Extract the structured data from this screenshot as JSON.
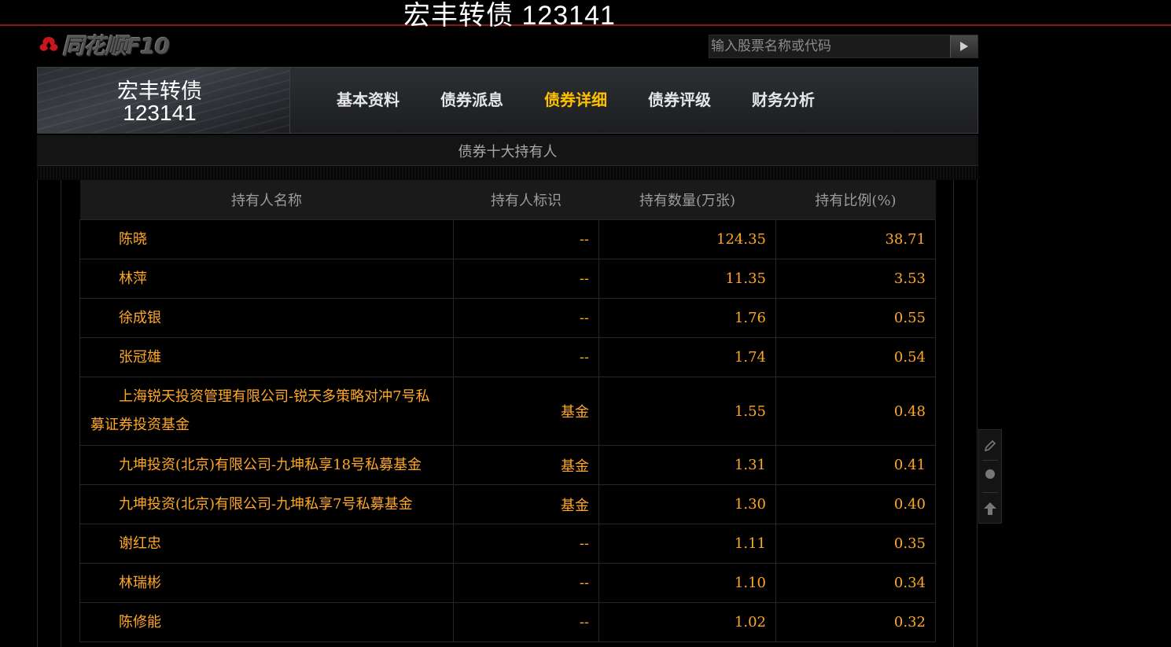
{
  "window": {
    "title": "宏丰转债 123141"
  },
  "brand": {
    "logo_text": "同花顺F10"
  },
  "search": {
    "placeholder": "输入股票名称或代码"
  },
  "stock": {
    "name": "宏丰转债",
    "code": "123141"
  },
  "nav": {
    "tabs": [
      {
        "label": "基本资料",
        "active": false
      },
      {
        "label": "债券派息",
        "active": false
      },
      {
        "label": "债券详细",
        "active": true
      },
      {
        "label": "债券评级",
        "active": false
      },
      {
        "label": "财务分析",
        "active": false
      }
    ]
  },
  "section": {
    "title": "债券十大持有人"
  },
  "table": {
    "headers": [
      "持有人名称",
      "持有人标识",
      "持有数量(万张)",
      "持有比例(%)"
    ],
    "rows": [
      {
        "name": "陈晓",
        "tag": "--",
        "qty": "124.35",
        "ratio": "38.71"
      },
      {
        "name": "林萍",
        "tag": "--",
        "qty": "11.35",
        "ratio": "3.53"
      },
      {
        "name": "徐成银",
        "tag": "--",
        "qty": "1.76",
        "ratio": "0.55"
      },
      {
        "name": "张冠雄",
        "tag": "--",
        "qty": "1.74",
        "ratio": "0.54"
      },
      {
        "name": "上海锐天投资管理有限公司-锐天多策略对冲7号私募证券投资基金",
        "tag": "基金",
        "qty": "1.55",
        "ratio": "0.48"
      },
      {
        "name": "九坤投资(北京)有限公司-九坤私享18号私募基金",
        "tag": "基金",
        "qty": "1.31",
        "ratio": "0.41"
      },
      {
        "name": "九坤投资(北京)有限公司-九坤私享7号私募基金",
        "tag": "基金",
        "qty": "1.30",
        "ratio": "0.40"
      },
      {
        "name": "谢红忠",
        "tag": "--",
        "qty": "1.11",
        "ratio": "0.35"
      },
      {
        "name": "林瑞彬",
        "tag": "--",
        "qty": "1.10",
        "ratio": "0.34"
      },
      {
        "name": "陈修能",
        "tag": "--",
        "qty": "1.02",
        "ratio": "0.32"
      }
    ]
  },
  "colors": {
    "accent": "#ffc000",
    "value": "#ffa726",
    "brand_red": "#c8161d"
  }
}
